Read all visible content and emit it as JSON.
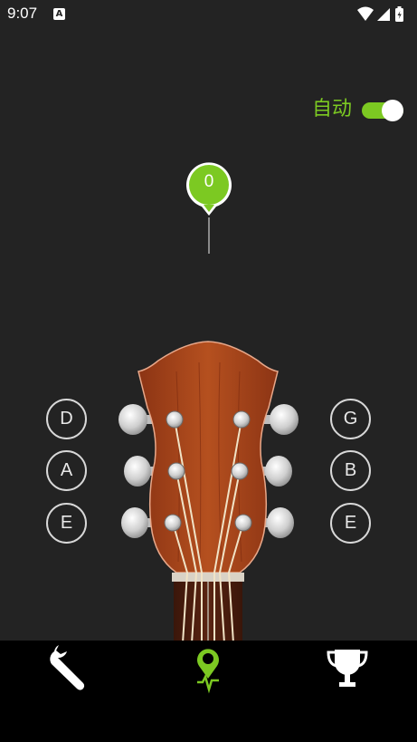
{
  "status_bar": {
    "time": "9:07",
    "notification_icon": "A"
  },
  "auto_mode": {
    "label": "自动",
    "enabled": true,
    "accent_color": "#7cc922"
  },
  "tuning_indicator": {
    "value": "0"
  },
  "strings": {
    "left": [
      {
        "note": "D"
      },
      {
        "note": "A"
      },
      {
        "note": "E"
      }
    ],
    "right": [
      {
        "note": "G"
      },
      {
        "note": "B"
      },
      {
        "note": "E"
      }
    ]
  },
  "bottom_nav": {
    "items": [
      {
        "icon": "wrench-icon",
        "active": false
      },
      {
        "icon": "tuner-pin-icon",
        "active": true
      },
      {
        "icon": "trophy-icon",
        "active": false
      }
    ]
  }
}
